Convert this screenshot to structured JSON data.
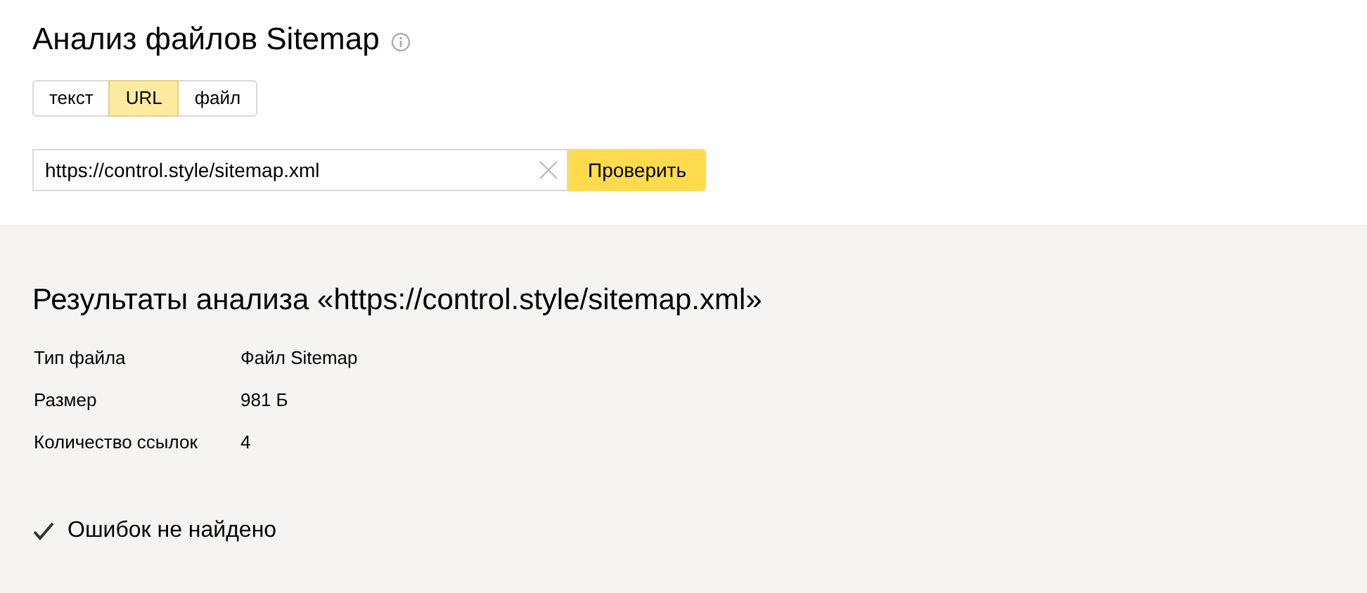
{
  "title": "Анализ файлов Sitemap",
  "tabs": [
    {
      "label": "текст",
      "selected": false
    },
    {
      "label": "URL",
      "selected": true
    },
    {
      "label": "файл",
      "selected": false
    }
  ],
  "url_field": {
    "value": "https://control.style/sitemap.xml"
  },
  "check_button": "Проверить",
  "results": {
    "heading": "Результаты анализа «https://control.style/sitemap.xml»",
    "rows": [
      {
        "label": "Тип файла",
        "value": "Файл Sitemap"
      },
      {
        "label": "Размер",
        "value": "981 Б"
      },
      {
        "label": "Количество ссылок",
        "value": "4"
      }
    ],
    "status": "Ошибок не найдено"
  }
}
